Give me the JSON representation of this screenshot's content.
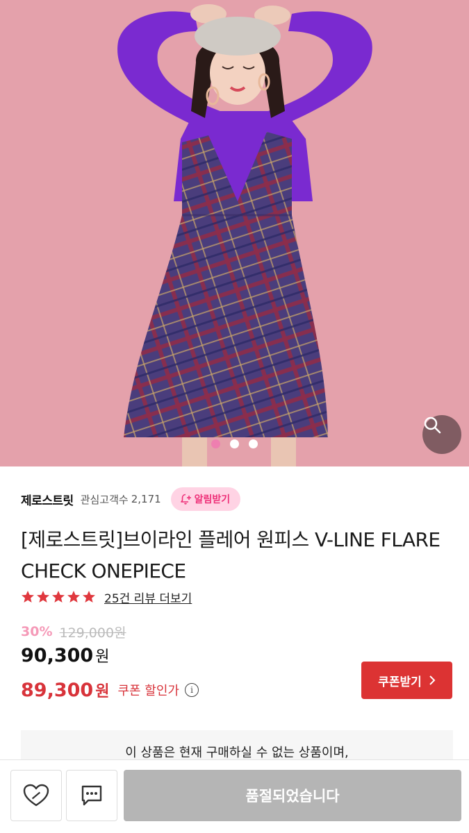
{
  "hero": {
    "image_description": "model-photo",
    "slide_count": 3,
    "active_slide": 1,
    "background_color": "#e4a1ab"
  },
  "store": {
    "name": "제로스트릿",
    "followers_label": "관심고객수",
    "followers_count": "2,171",
    "alert_button": "알림받기"
  },
  "product": {
    "title": "[제로스트릿]브이라인 플레어 원피스 V-LINE FLARE CHECK ONEPIECE",
    "rating_stars": 5,
    "review_link": "25건 리뷰 더보기",
    "discount_rate": "30%",
    "original_price": "129,000원",
    "price": "90,300",
    "price_unit": "원",
    "coupon_price": "89,300",
    "coupon_unit": "원",
    "coupon_label": "쿠폰 할인가",
    "coupon_button": "쿠폰받기",
    "notice": "이 상품은 현재 구매하실 수 없는 상품이며,"
  },
  "bottom_bar": {
    "wishlist_icon": "heart-icon",
    "chat_icon": "chat-icon",
    "soldout_button": "품절되었습니다"
  },
  "colors": {
    "accent_red": "#dc3333",
    "coupon_red": "#d8333a",
    "pink_alert_bg": "#ffd3e4",
    "pink_alert_text": "#ee2f78",
    "discount_pink": "#f59ab8",
    "disabled_gray": "#b5b5b5"
  }
}
